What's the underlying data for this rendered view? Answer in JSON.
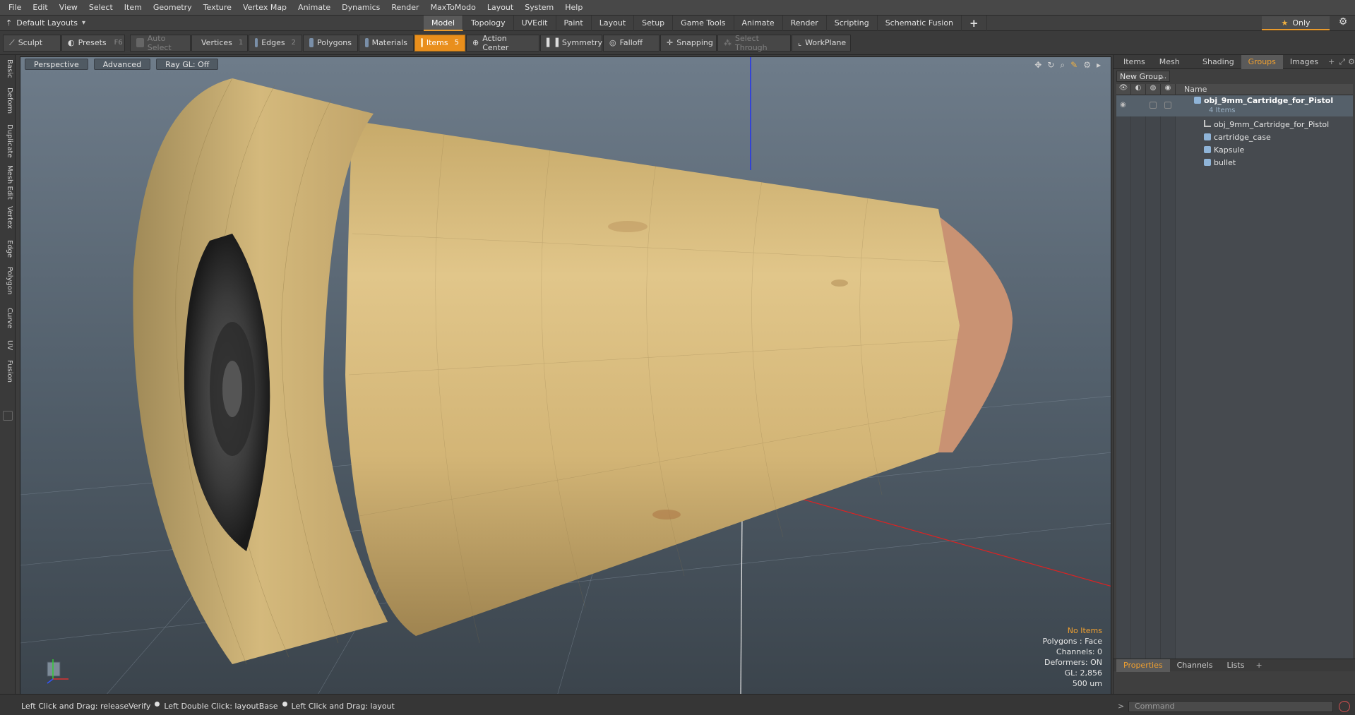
{
  "menu": [
    "File",
    "Edit",
    "View",
    "Select",
    "Item",
    "Geometry",
    "Texture",
    "Vertex Map",
    "Animate",
    "Dynamics",
    "Render",
    "MaxToModo",
    "Layout",
    "System",
    "Help"
  ],
  "layout": {
    "selector": "Default Layouts",
    "tabs": [
      "Model",
      "Topology",
      "UVEdit",
      "Paint",
      "Layout",
      "Setup",
      "Game Tools",
      "Animate",
      "Render",
      "Scripting",
      "Schematic Fusion"
    ],
    "active_tab": "Model",
    "plus": "+",
    "only_label": "Only"
  },
  "toolbar": {
    "sculpt": "Sculpt",
    "presets": "Presets",
    "presets_key": "F6",
    "auto_select": "Auto Select",
    "vertices": "Vertices",
    "vertices_num": "1",
    "edges": "Edges",
    "edges_num": "2",
    "polygons": "Polygons",
    "materials": "Materials",
    "items": "Items",
    "items_num": "5",
    "action_center": "Action Center",
    "symmetry": "Symmetry",
    "falloff": "Falloff",
    "snapping": "Snapping",
    "select_through": "Select Through",
    "workplane": "WorkPlane"
  },
  "left_tabs": [
    "Basic",
    "Deform",
    "Duplicate",
    "Mesh Edit",
    "Vertex",
    "Edge",
    "Polygon",
    "Curve",
    "UV",
    "Fusion"
  ],
  "viewport": {
    "view_mode": "Perspective",
    "shading_mode": "Advanced",
    "raygl": "Ray GL: Off",
    "info": {
      "no_items": "No Items",
      "polygons": "Polygons : Face",
      "channels": "Channels: 0",
      "deformers": "Deformers: ON",
      "gl": "GL: 2,856",
      "units": "500 um"
    }
  },
  "right_panel": {
    "tabs": [
      "Items",
      "Mesh ...",
      "Shading",
      "Groups",
      "Images"
    ],
    "active_tab": "Groups",
    "new_group": "New Group",
    "header_name": "Name",
    "group": {
      "name": "obj_9mm_Cartridge_for_Pistol",
      "count": "4 Items"
    },
    "children": [
      {
        "name": "obj_9mm_Cartridge_for_Pistol",
        "icon": "locator-icon"
      },
      {
        "name": "cartridge_case",
        "icon": "mesh-icon"
      },
      {
        "name": "Kapsule",
        "icon": "mesh-icon"
      },
      {
        "name": "bullet",
        "icon": "mesh-icon"
      }
    ],
    "bottom_tabs": [
      "Properties",
      "Channels",
      "Lists"
    ],
    "bottom_active": "Properties"
  },
  "status": {
    "line1": "Left Click and Drag: releaseVerify",
    "line2": "Left Double Click: layoutBase",
    "line3": "Left Click and Drag: layout",
    "command_placeholder": "Command"
  },
  "colors": {
    "accent": "#e98f1c",
    "case": "#d6b978",
    "bullet": "#c98f6e"
  }
}
